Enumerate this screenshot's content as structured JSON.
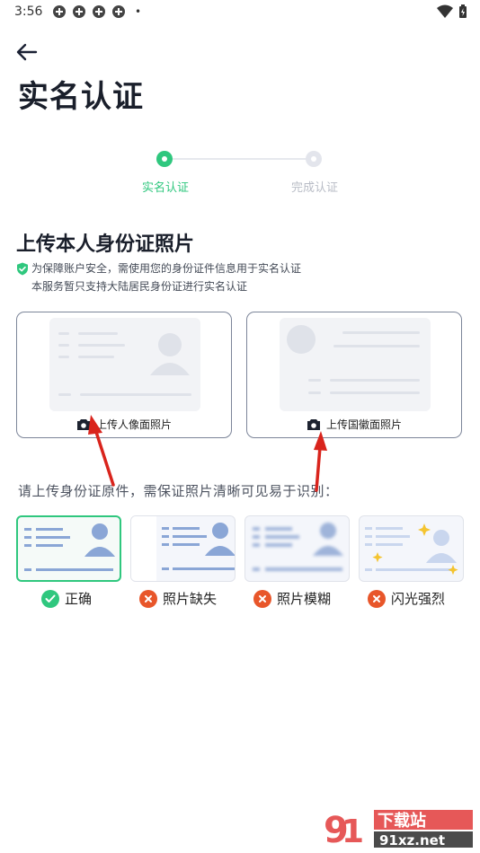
{
  "status_bar": {
    "time": "3:56"
  },
  "header": {
    "title": "实名认证"
  },
  "stepper": {
    "steps": [
      {
        "label": "实名认证",
        "state": "active"
      },
      {
        "label": "完成认证",
        "state": "inactive"
      }
    ],
    "active_color": "#2fc77e"
  },
  "upload": {
    "title": "上传本人身份证照片",
    "notice_line1": "为保障账户安全，需使用您的身份证件信息用于实名认证",
    "notice_line2": "本服务暂只支持大陆居民身份证进行实名认证",
    "front_label": "上传人像面照片",
    "back_label": "上传国徽面照片"
  },
  "requirements": {
    "hint": "请上传身份证原件，需保证照片清晰可见易于识别：",
    "examples": [
      {
        "label": "正确",
        "status": "ok"
      },
      {
        "label": "照片缺失",
        "status": "error"
      },
      {
        "label": "照片模糊",
        "status": "error"
      },
      {
        "label": "闪光强烈",
        "status": "error"
      }
    ]
  },
  "watermark": {
    "logo_text": "下载站",
    "domain": "91xz.net"
  }
}
